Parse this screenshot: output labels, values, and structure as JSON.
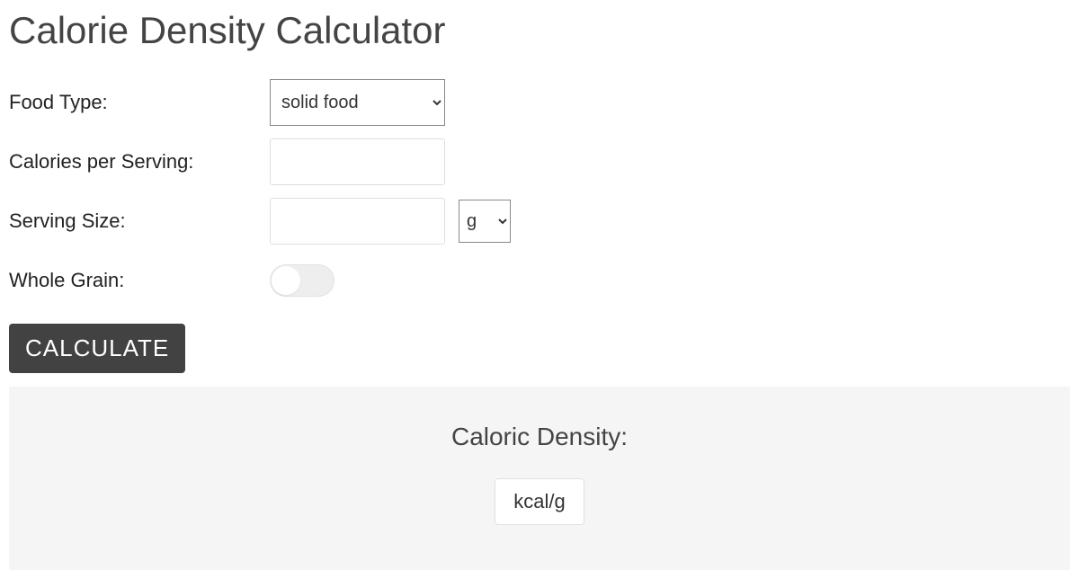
{
  "page": {
    "title": "Calorie Density Calculator"
  },
  "form": {
    "food_type": {
      "label": "Food Type:",
      "selected": "solid food"
    },
    "calories_per_serving": {
      "label": "Calories per Serving:",
      "value": ""
    },
    "serving_size": {
      "label": "Serving Size:",
      "value": "",
      "unit_selected": "g"
    },
    "whole_grain": {
      "label": "Whole Grain:",
      "checked": false
    },
    "calculate_button": "CALCULATE"
  },
  "result": {
    "title": "Caloric Density:",
    "value": "",
    "unit": "kcal/g"
  }
}
